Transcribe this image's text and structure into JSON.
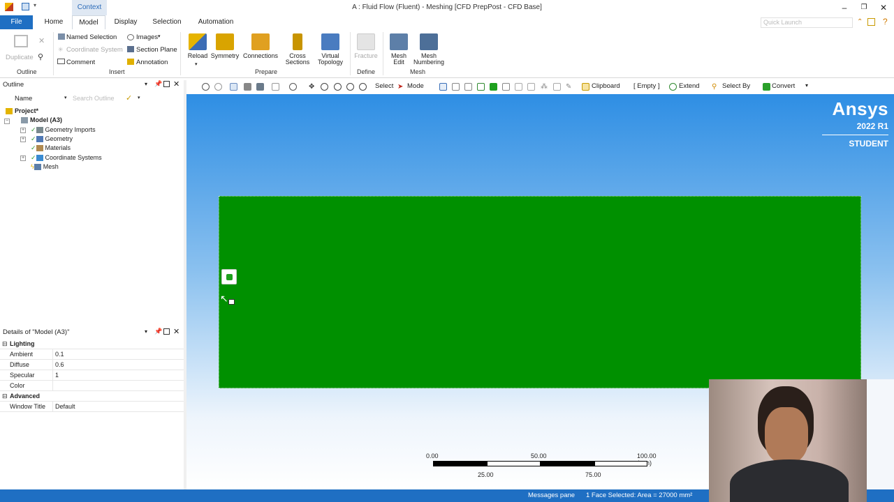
{
  "window": {
    "context_tab": "Context",
    "title": "A : Fluid Flow (Fluent) - Meshing [CFD PrepPost - CFD Base]",
    "quick_launch_placeholder": "Quick Launch"
  },
  "tabs": [
    "File",
    "Home",
    "Model",
    "Display",
    "Selection",
    "Automation"
  ],
  "ribbon": {
    "outline": {
      "duplicate": "Duplicate",
      "label": "Outline"
    },
    "insert": {
      "named_selection": "Named Selection",
      "coordinate_system": "Coordinate System",
      "comment": "Comment",
      "images": "Images",
      "section_plane": "Section Plane",
      "annotation": "Annotation",
      "label": "Insert"
    },
    "prepare": {
      "reload": "Reload",
      "symmetry": "Symmetry",
      "connections": "Connections",
      "cross_sections_1": "Cross",
      "cross_sections_2": "Sections",
      "virtual_topology_1": "Virtual",
      "virtual_topology_2": "Topology",
      "label": "Prepare"
    },
    "define": {
      "fracture": "Fracture",
      "label": "Define"
    },
    "mesh": {
      "mesh_edit_1": "Mesh",
      "mesh_edit_2": "Edit",
      "mesh_numbering_1": "Mesh",
      "mesh_numbering_2": "Numbering",
      "label": "Mesh"
    }
  },
  "outline": {
    "title": "Outline",
    "name_label": "Name",
    "search_placeholder": "Search Outline",
    "tree": {
      "project": "Project*",
      "model": "Model (A3)",
      "geometry_imports": "Geometry Imports",
      "geometry": "Geometry",
      "materials": "Materials",
      "coordinate_systems": "Coordinate Systems",
      "mesh": "Mesh"
    }
  },
  "details": {
    "title": "Details of \"Model (A3)\"",
    "lighting": "Lighting",
    "ambient_k": "Ambient",
    "ambient_v": "0.1",
    "diffuse_k": "Diffuse",
    "diffuse_v": "0.6",
    "specular_k": "Specular",
    "specular_v": "1",
    "color_k": "Color",
    "color_v": "",
    "advanced": "Advanced",
    "window_title_k": "Window Title",
    "window_title_v": "Default"
  },
  "graphics_toolbar": {
    "select": "Select",
    "mode": "Mode",
    "clipboard": "Clipboard",
    "empty": "[ Empty ]",
    "extend": "Extend",
    "select_by": "Select By",
    "convert": "Convert"
  },
  "viewport": {
    "brand": "Ansys",
    "version": "2022 R1",
    "edition": "STUDENT",
    "geometry_color": "#009000",
    "scale": {
      "top": [
        "0.00",
        "50.00",
        "100.00 (mm)"
      ],
      "bottom": [
        "25.00",
        "75.00"
      ]
    }
  },
  "status": {
    "messages": "Messages pane",
    "selection": "1 Face Selected: Area = 27000 mm²"
  },
  "colors": {
    "accent": "#1f6fc3"
  }
}
